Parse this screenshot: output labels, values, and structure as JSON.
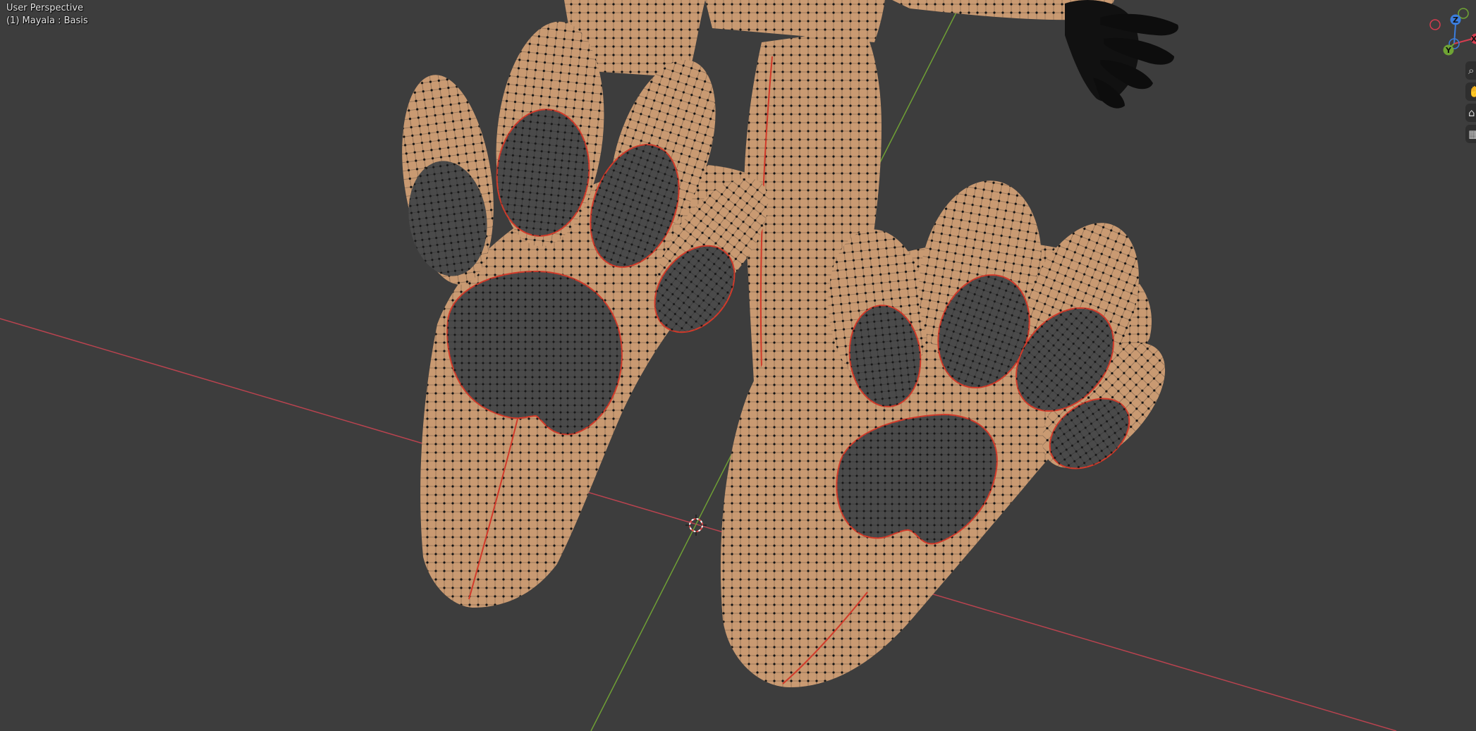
{
  "viewport": {
    "view_name": "User Perspective",
    "object_info": "(1) Mayala : Basis",
    "background_color": "#3d3d3d"
  },
  "gizmo": {
    "z_label": "Z",
    "y_label": "Y",
    "x_label": "X",
    "x_color": "#d63d4f",
    "y_color": "#6fa434",
    "z_color": "#3b7ddd"
  },
  "tools": [
    {
      "icon": "zoom-icon",
      "glyph": "⌕"
    },
    {
      "icon": "hand-icon",
      "glyph": "✋"
    },
    {
      "icon": "camera-icon",
      "glyph": "⌂"
    },
    {
      "icon": "grid-icon",
      "glyph": "▦"
    }
  ],
  "colors": {
    "skin": "#c99a72",
    "pad": "#4a4a4a",
    "seam": "#d23a2a",
    "axis_x": "#b8434f",
    "axis_y": "#6f9f35"
  }
}
